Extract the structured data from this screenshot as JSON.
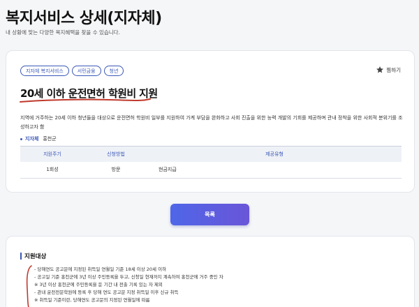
{
  "page": {
    "title": "복지서비스 상세(지자체)",
    "subtitle": "내 상황에 맞는 다양한 복지혜택을 찾을 수 있습니다."
  },
  "service": {
    "tags": [
      "지자체 복지서비스",
      "서민금융",
      "청년"
    ],
    "favorite_label": "찜하기",
    "title": "20세 이하 운전면허 학원비 지원",
    "description": "지역에 거주하는 20세 이하 청년들을 대상으로 운전면허 학원비 일부를 지원하여 가계 부담을 완화하고 사회 진출을 위한 능력 개발의 기회를 제공하며 관내 정착을 위한 사회적 분위기를 조성하고자 함",
    "org_label": "지자체",
    "org_value": "홍천군",
    "table": {
      "headers": [
        "지원주기",
        "신청방법",
        "제공유형"
      ],
      "row": [
        "1회성",
        "방문",
        "현금지급"
      ]
    }
  },
  "list_button_label": "목록",
  "eligibility": {
    "title": "지원대상",
    "items": [
      "- 당해연도 공고문에 지정된 취득일 연월일 기준 18세 이상 20세 이하",
      "- 공고일 기준 홍천군에 3년 이상 주민등록을 두고, 신청일 현재까지 계속하여 홍천군에 거주 중인 자",
      "※ 3년 이상 홍천군에 주민등록을 둔 기간 내 전출 기록 있는 자 제외",
      "- 관내 운전전문학원에 등록 후 당해 연도 공고문 지정 취득일 이후 신규 취득",
      "※ 취득일 기준이란, 당해연도 공고문의 지정된 연월일에 따름"
    ]
  },
  "colors": {
    "accent": "#3a57b7",
    "annotation": "#c0392b",
    "button_gradient_start": "#4f66e8",
    "button_gradient_end": "#6a55d8"
  },
  "icons": {
    "favorite": "star-icon"
  }
}
